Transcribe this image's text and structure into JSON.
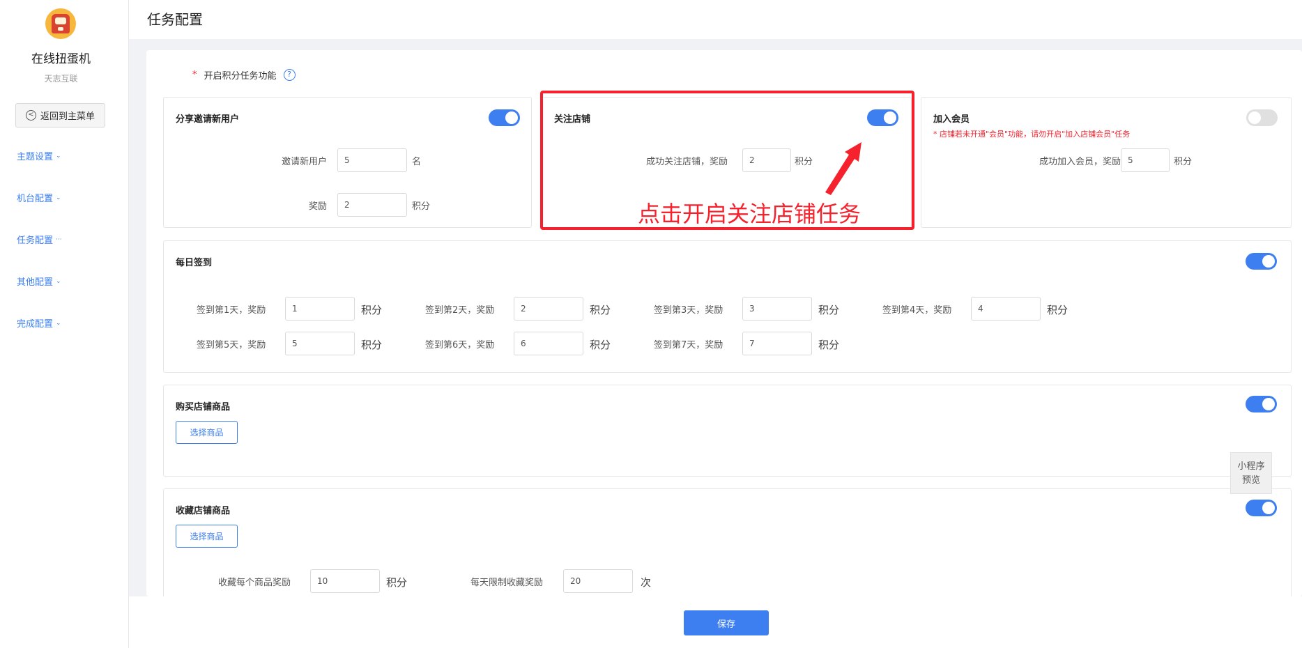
{
  "sidebar": {
    "app_name": "在线扭蛋机",
    "app_sub": "天志互联",
    "back_label": "返回到主菜单",
    "back_icon": "<",
    "items": [
      {
        "label": "主题设置",
        "caret": "⌄"
      },
      {
        "label": "机台配置",
        "caret": "⌄"
      },
      {
        "label": "任务配置",
        "caret": "···"
      },
      {
        "label": "其他配置",
        "caret": "⌄"
      },
      {
        "label": "完成配置",
        "caret": "⌄"
      }
    ]
  },
  "header": {
    "title": "任务配置"
  },
  "feature": {
    "required_mark": "*",
    "label": "开启积分任务功能",
    "help": "?"
  },
  "share_card": {
    "title": "分享邀请新用户",
    "enabled": true,
    "invite_label": "邀请新用户",
    "invite_value": "5",
    "invite_unit": "名",
    "reward_label": "奖励",
    "reward_value": "2",
    "reward_unit": "积分"
  },
  "follow_card": {
    "title": "关注店铺",
    "enabled": true,
    "label": "成功关注店铺，奖励",
    "value": "2",
    "unit": "积分"
  },
  "member_card": {
    "title": "加入会员",
    "enabled": false,
    "warning": "* 店铺若未开通\"会员\"功能，请勿开启\"加入店铺会员\"任务",
    "label": "成功加入会员，奖励",
    "value": "5",
    "unit": "积分"
  },
  "annotation": {
    "text": "点击开启关注店铺任务"
  },
  "checkin_card": {
    "title": "每日签到",
    "enabled": true,
    "unit": "积分",
    "days": [
      {
        "label": "签到第1天，奖励",
        "value": "1"
      },
      {
        "label": "签到第2天，奖励",
        "value": "2"
      },
      {
        "label": "签到第3天，奖励",
        "value": "3"
      },
      {
        "label": "签到第4天，奖励",
        "value": "4"
      },
      {
        "label": "签到第5天，奖励",
        "value": "5"
      },
      {
        "label": "签到第6天，奖励",
        "value": "6"
      },
      {
        "label": "签到第7天，奖励",
        "value": "7"
      }
    ]
  },
  "buy_card": {
    "title": "购买店铺商品",
    "enabled": true,
    "select_label": "选择商品"
  },
  "collect_card": {
    "title": "收藏店铺商品",
    "enabled": true,
    "select_label": "选择商品",
    "reward_label": "收藏每个商品奖励",
    "reward_value": "10",
    "reward_unit": "积分",
    "limit_label": "每天限制收藏奖励",
    "limit_value": "20",
    "limit_unit": "次"
  },
  "preview": {
    "line1": "小程序",
    "line2": "预览"
  },
  "footer": {
    "save_label": "保存"
  },
  "colors": {
    "accent": "#3d7ff0",
    "danger": "#f5222d"
  }
}
